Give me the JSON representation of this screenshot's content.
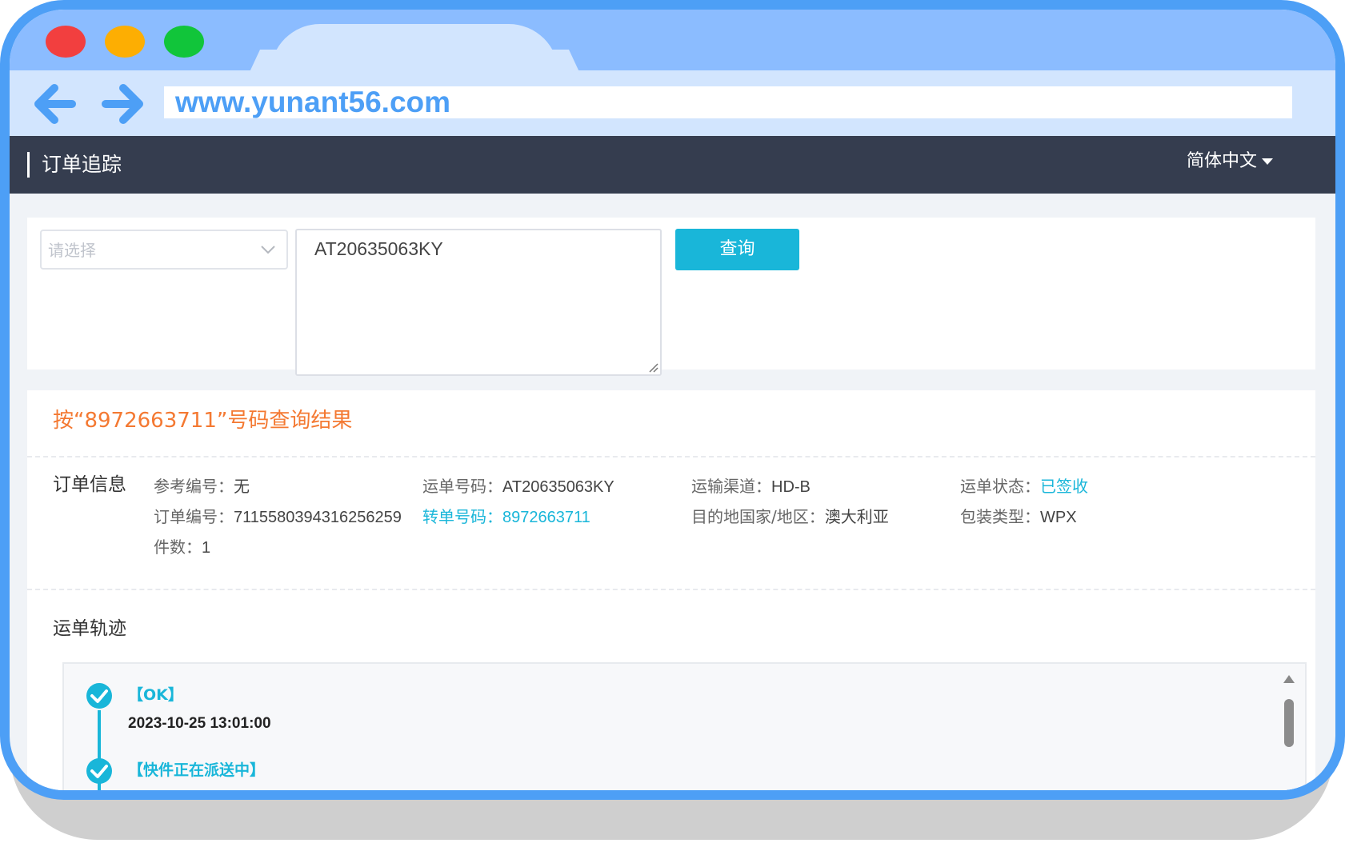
{
  "browser": {
    "url": "www.yunant56.com"
  },
  "app": {
    "title": "订单追踪",
    "language": "简体中文"
  },
  "search": {
    "select_placeholder": "请选择",
    "tracking_input": "AT20635063KY",
    "query_button": "查询"
  },
  "result": {
    "title": "按“8972663711”号码查询结果",
    "order_info_label": "订单信息",
    "fields": {
      "ref_no_label": "参考编号：",
      "ref_no": "无",
      "waybill_label": "运单号码：",
      "waybill": "AT20635063KY",
      "channel_label": "运输渠道：",
      "channel": "HD-B",
      "status_label": "运单状态：",
      "status": "已签收",
      "order_no_label": "订单编号：",
      "order_no": "7115580394316256259",
      "transfer_label": "转单号码：",
      "transfer": "8972663711",
      "destination_label": "目的地国家/地区：",
      "destination": "澳大利亚",
      "package_label": "包装类型：",
      "package": "WPX",
      "pieces_label": "件数：",
      "pieces": "1"
    }
  },
  "tracking": {
    "label": "运单轨迹",
    "events": [
      {
        "status": "【OK】",
        "time": "2023-10-25 13:01:00"
      },
      {
        "status": "【快件正在派送中】"
      }
    ]
  },
  "colors": {
    "accent": "#19b6d9",
    "frame": "#4d9ff6",
    "header": "#353d4f",
    "result_title": "#f47932"
  }
}
